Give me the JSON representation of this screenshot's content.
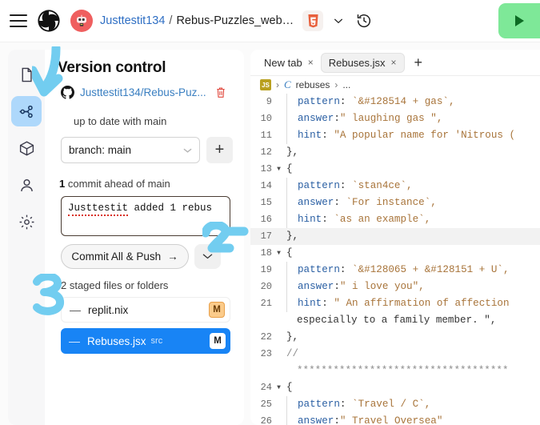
{
  "topbar": {
    "menu_icon": "hamburger-menu-icon",
    "logo_icon": "replit-logo-icon",
    "avatar_icon": "robot-avatar-icon",
    "username": "Justtestit134",
    "separator": "/",
    "repo_name": "Rebus-Puzzles_webp...",
    "file_type_icon": "html5-icon",
    "chevron_icon": "chevron-down-icon",
    "history_icon": "history-clock-icon",
    "run_icon": "run-play-icon"
  },
  "rail": {
    "items": [
      {
        "name": "files-icon",
        "active": false
      },
      {
        "name": "version-control-icon",
        "active": true
      },
      {
        "name": "packages-cube-icon",
        "active": false
      },
      {
        "name": "user-person-icon",
        "active": false
      },
      {
        "name": "settings-gear-icon",
        "active": false
      }
    ]
  },
  "version_control": {
    "title": "Version control",
    "github_icon": "github-icon",
    "repo_link": "Justtestit134/Rebus-Puz...",
    "delete_icon": "trash-icon",
    "sync_status": "up to date with main",
    "branch_label": "branch: main",
    "branch_caret_icon": "caret-down-icon",
    "add_branch_label": "+",
    "commits_ahead_count": "1",
    "commits_ahead_text": "commit ahead of main",
    "commit_message": "Justtestit added 1 rebus",
    "commit_message_misspelled_word": "Justtestit",
    "commit_message_rest": " added 1 rebus",
    "commit_button_label": "Commit All & Push",
    "commit_button_arrow": "→",
    "commit_dropdown_icon": "chevron-down-icon",
    "staged_label": "2 staged files or folders",
    "files": [
      {
        "status_dash": "—",
        "name": "replit.nix",
        "path": "",
        "badge": "M",
        "selected": false
      },
      {
        "status_dash": "—",
        "name": "Rebuses.jsx",
        "path": "src",
        "badge": "M",
        "selected": true
      }
    ]
  },
  "editor": {
    "tabs": [
      {
        "label": "New tab",
        "close": "×",
        "active": false
      },
      {
        "label": "Rebuses.jsx",
        "close": "×",
        "active": true
      }
    ],
    "new_tab_plus": "+",
    "breadcrumb": {
      "lang_chip": "JS",
      "sep1": "›",
      "component": "C",
      "scope": "rebuses",
      "sep2": "›",
      "ellipsis": "..."
    },
    "lines": [
      {
        "num": "9",
        "fold": "",
        "text": "pattern: `&#128514 + gas`,",
        "indent": true,
        "highlight": false
      },
      {
        "num": "10",
        "fold": "",
        "text": "answer:\" laughing gas \",",
        "indent": true,
        "highlight": false
      },
      {
        "num": "11",
        "fold": "",
        "text": "hint: \"A popular name for 'Nitrous (",
        "indent": true,
        "highlight": false
      },
      {
        "num": "12",
        "fold": "",
        "text": "},",
        "indent": false,
        "highlight": false
      },
      {
        "num": "13",
        "fold": "▼",
        "text": "{",
        "indent": false,
        "highlight": false
      },
      {
        "num": "14",
        "fold": "",
        "text": "pattern: `stan4ce`,",
        "indent": true,
        "highlight": false
      },
      {
        "num": "15",
        "fold": "",
        "text": "answer: `For instance`,",
        "indent": true,
        "highlight": false
      },
      {
        "num": "16",
        "fold": "",
        "text": "hint: `as an example`,",
        "indent": true,
        "highlight": false
      },
      {
        "num": "17",
        "fold": "",
        "text": "},",
        "indent": false,
        "highlight": true
      },
      {
        "num": "18",
        "fold": "▼",
        "text": "{",
        "indent": false,
        "highlight": false
      },
      {
        "num": "19",
        "fold": "",
        "text": "pattern: `&#128065 + &#128151 + U`,",
        "indent": true,
        "highlight": false
      },
      {
        "num": "20",
        "fold": "",
        "text": "answer:\" i love you\",",
        "indent": true,
        "highlight": false
      },
      {
        "num": "21",
        "fold": "",
        "text": "hint: \" An affirmation of affection",
        "indent": true,
        "highlight": false
      },
      {
        "num": "",
        "fold": "",
        "text": "especially to a family member. \",",
        "indent": false,
        "highlight": false,
        "wrap": true
      },
      {
        "num": "22",
        "fold": "",
        "text": "},",
        "indent": false,
        "highlight": false
      },
      {
        "num": "23",
        "fold": "",
        "text": "//",
        "indent": false,
        "highlight": false,
        "comment": true
      },
      {
        "num": "",
        "fold": "",
        "text": "***********************************",
        "indent": false,
        "highlight": false,
        "comment": true,
        "wrap": true
      },
      {
        "num": "24",
        "fold": "▼",
        "text": "{",
        "indent": false,
        "highlight": false
      },
      {
        "num": "25",
        "fold": "",
        "text": "pattern: `Travel / C`,",
        "indent": true,
        "highlight": false
      },
      {
        "num": "26",
        "fold": "",
        "text": "answer:\" Travel Oversea\"",
        "indent": true,
        "highlight": false
      }
    ]
  },
  "annotations": {
    "arrow_1": "blue-arrow-pointing-to-version-control-icon",
    "number_2": "2",
    "number_3": "3",
    "color": "#72cdf0"
  }
}
